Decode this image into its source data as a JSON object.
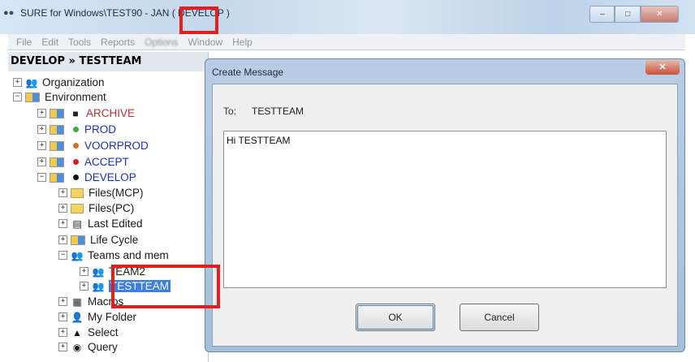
{
  "window": {
    "title_main": "SURE for Windows\\TEST90",
    "title_env": "- JAN ( DEVELOP )",
    "min_icon": "–",
    "max_icon": "□",
    "close_icon": "✕"
  },
  "menu": [
    "File",
    "Edit",
    "Tools",
    "Reports",
    "Options",
    "Window",
    "Help"
  ],
  "panel": {
    "header": "DEVELOP » TESTTEAM"
  },
  "tree": {
    "organization": "Organization",
    "environment": "Environment",
    "archive": "ARCHIVE",
    "prod": "PROD",
    "voorprod": "VOORPROD",
    "accept": "ACCEPT",
    "develop": "DEVELOP",
    "files_mcp": "Files(MCP)",
    "files_pc": "Files(PC)",
    "last_edited": "Last Edited",
    "life_cycle": "Life Cycle",
    "teams": "Teams and mem",
    "team2": "TEAM2",
    "testteam": "TESTTEAM",
    "macros": "Macros",
    "my_folder": "My Folder",
    "select": "Select",
    "query": "Query"
  },
  "dialog": {
    "title": "Create Message",
    "close_label": "✕",
    "to_label": "To:",
    "to_value": "TESTTEAM",
    "message": "Hi TESTTEAM",
    "ok_label": "OK",
    "cancel_label": "Cancel"
  },
  "colors": {
    "highlight": "#e41e1e",
    "selection": "#3b7fe0",
    "archive": "#c03030",
    "env_blue": "#1a30c0"
  }
}
